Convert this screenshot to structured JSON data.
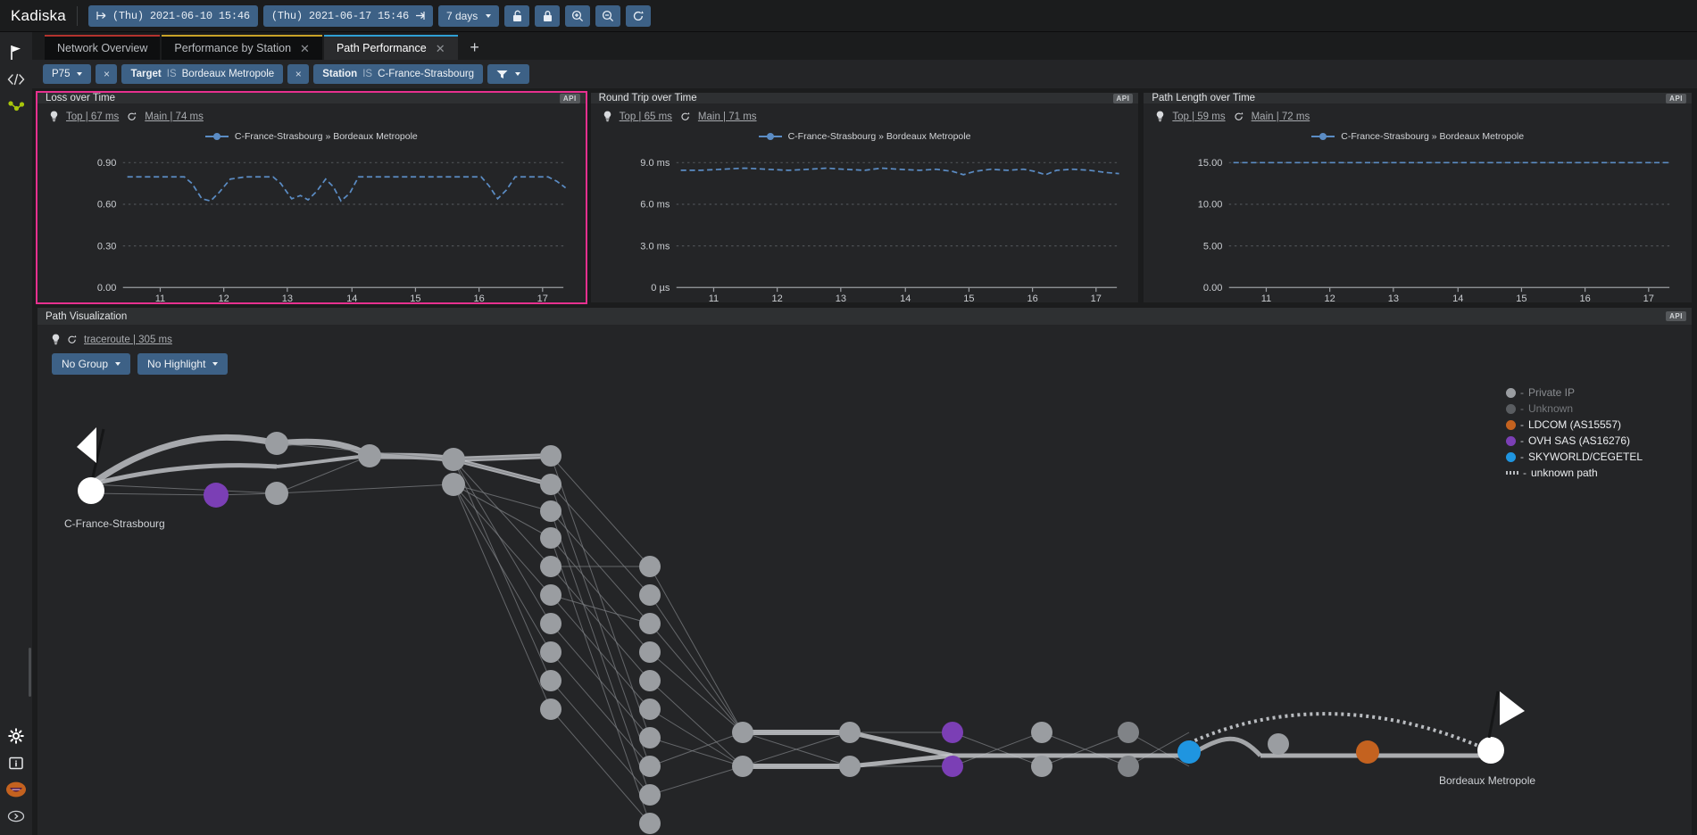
{
  "topbar": {
    "brand": "Kadiska",
    "start_date": "(Thu) 2021-06-10 15:46",
    "end_date": "(Thu) 2021-06-17 15:46",
    "range_label": "7 days",
    "icons": [
      "lock-open-icon",
      "lock-closed-icon",
      "zoom-in-icon",
      "zoom-out-icon",
      "refresh-icon"
    ]
  },
  "rail": {
    "items": [
      {
        "name": "flag-icon",
        "label": "flag"
      },
      {
        "name": "code-icon",
        "label": "</>"
      },
      {
        "name": "path-graph-icon",
        "label": "path"
      }
    ],
    "bottom": [
      {
        "name": "gear-icon",
        "label": "settings"
      },
      {
        "name": "info-box-icon",
        "label": "info"
      },
      {
        "name": "avatar-icon",
        "label": "user"
      },
      {
        "name": "collapse-icon",
        "label": "expand"
      }
    ]
  },
  "tabs": [
    {
      "label": "Network Overview",
      "accent": "#b4332e",
      "closable": false,
      "active": false
    },
    {
      "label": "Performance by Station",
      "accent": "#c9a227",
      "closable": true,
      "active": false
    },
    {
      "label": "Path Performance",
      "accent": "#2f9fd4",
      "closable": true,
      "active": true
    }
  ],
  "tab_add_label": "+",
  "filters": {
    "percentile": "P75",
    "chips": [
      {
        "remove": "×",
        "key": "Target",
        "op": "IS",
        "value": "Bordeaux Metropole"
      },
      {
        "remove": "×",
        "key": "Station",
        "op": "IS",
        "value": "C-France-Strasbourg"
      }
    ],
    "funnel_label": "filter-icon"
  },
  "panels": [
    {
      "title": "Loss over Time",
      "badge": "API",
      "selected": true,
      "links": [
        {
          "text": "Top | 67 ms"
        },
        {
          "text": "Main | 74 ms"
        }
      ],
      "legend": "C-France-Strasbourg » Bordeaux Metropole"
    },
    {
      "title": "Round Trip over Time",
      "badge": "API",
      "selected": false,
      "links": [
        {
          "text": "Top | 65 ms"
        },
        {
          "text": "Main | 71 ms"
        }
      ],
      "legend": "C-France-Strasbourg » Bordeaux Metropole"
    },
    {
      "title": "Path Length over Time",
      "badge": "API",
      "selected": false,
      "links": [
        {
          "text": "Top | 59 ms"
        },
        {
          "text": "Main | 72 ms"
        }
      ],
      "legend": "C-France-Strasbourg » Bordeaux Metropole"
    }
  ],
  "path_panel": {
    "title": "Path Visualization",
    "badge": "API",
    "link": "traceroute | 305 ms",
    "group_button": "No Group",
    "highlight_button": "No Highlight",
    "source_label": "C-France-Strasbourg",
    "target_label": "Bordeaux Metropole",
    "legend": [
      {
        "label": "Private IP",
        "color": "#9a9da1",
        "type": "dot",
        "dim": true
      },
      {
        "label": "Unknown",
        "color": "#5a5d61",
        "type": "dot",
        "dim": true
      },
      {
        "label": "LDCOM (AS15557)",
        "color": "#c4621f",
        "type": "dot",
        "dim": false
      },
      {
        "label": "OVH SAS (AS16276)",
        "color": "#7b3fb5",
        "type": "dot",
        "dim": false
      },
      {
        "label": "SKYWORLD/CEGETEL",
        "color": "#1f95e0",
        "type": "dot",
        "dim": false
      },
      {
        "label": "unknown path",
        "color": "#b9bcc0",
        "type": "dash",
        "dim": false
      }
    ]
  },
  "chart_data": [
    {
      "type": "line",
      "title": "Loss over Time",
      "xlabel": "",
      "ylabel": "",
      "series": [
        {
          "name": "C-France-Strasbourg » Bordeaux Metropole",
          "color": "#5b8cc4",
          "values": [
            0.8,
            0.8,
            0.8,
            0.8,
            0.8,
            0.8,
            0.8,
            0.8,
            0.7,
            0.67,
            0.68,
            0.72,
            0.8,
            0.8,
            0.8,
            0.8,
            0.8,
            0.8,
            0.8,
            0.7,
            0.68,
            0.72,
            0.7,
            0.68,
            0.72,
            0.8,
            0.8,
            0.72,
            0.68,
            0.8,
            0.8,
            0.8,
            0.8,
            0.8,
            0.8,
            0.8,
            0.8,
            0.8,
            0.8,
            0.8,
            0.8,
            0.8,
            0.8,
            0.8,
            0.8,
            0.8,
            0.8,
            0.8,
            0.72,
            0.68,
            0.76,
            0.8,
            0.8,
            0.8,
            0.8,
            0.8,
            0.8,
            0.8,
            0.78,
            0.75
          ]
        }
      ],
      "x": [
        11,
        12,
        13,
        14,
        15,
        16,
        17
      ],
      "xticklabels": [
        "11",
        "12",
        "13",
        "14",
        "15",
        "16",
        "17"
      ],
      "yticklabels": [
        "0.90",
        "0.60",
        "0.30",
        "0.00"
      ],
      "yticks": [
        0.9,
        0.6,
        0.3,
        0.0
      ],
      "ylim": [
        0,
        1.05
      ],
      "grid": true,
      "legend_position": "top"
    },
    {
      "type": "line",
      "title": "Round Trip over Time",
      "xlabel": "",
      "ylabel": "ms",
      "series": [
        {
          "name": "C-France-Strasbourg » Bordeaux Metropole",
          "color": "#5b8cc4",
          "values": [
            8.5,
            8.5,
            8.6,
            8.6,
            8.7,
            8.7,
            8.7,
            8.6,
            8.6,
            8.6,
            8.6,
            8.6,
            8.6,
            8.7,
            8.7,
            8.6,
            8.6,
            8.6,
            8.5,
            8.5,
            8.6,
            8.6,
            8.6,
            8.6,
            8.7,
            8.7,
            8.6,
            8.6,
            8.6,
            8.6,
            8.7,
            8.7,
            8.6,
            8.5,
            8.6,
            8.6,
            8.6,
            8.5,
            8.4,
            8.3,
            8.5,
            8.6,
            8.6,
            8.6,
            8.5,
            8.5,
            8.6,
            8.6,
            8.5,
            8.3,
            8.2,
            8.4,
            8.6,
            8.6,
            8.6,
            8.6,
            8.5,
            8.4,
            8.3,
            8.2
          ]
        }
      ],
      "x": [
        11,
        12,
        13,
        14,
        15,
        16,
        17
      ],
      "xticklabels": [
        "11",
        "12",
        "13",
        "14",
        "15",
        "16",
        "17"
      ],
      "yticklabels": [
        "9.0 ms",
        "6.0 ms",
        "3.0 ms",
        "0 µs"
      ],
      "yticks": [
        9.0,
        6.0,
        3.0,
        0.0
      ],
      "ylim": [
        0,
        10.5
      ],
      "grid": true,
      "legend_position": "top"
    },
    {
      "type": "line",
      "title": "Path Length over Time",
      "xlabel": "",
      "ylabel": "",
      "series": [
        {
          "name": "C-France-Strasbourg » Bordeaux Metropole",
          "color": "#5b8cc4",
          "values": [
            15,
            15,
            15,
            15,
            15,
            15,
            15,
            15,
            15,
            15,
            15,
            15,
            15,
            15,
            15,
            15,
            15,
            15,
            15,
            15,
            15,
            15,
            15,
            15,
            15,
            15,
            15,
            15,
            15,
            15,
            15,
            15,
            15,
            15,
            15,
            15,
            15,
            15,
            15,
            15,
            15,
            15,
            15,
            15,
            15,
            15,
            15,
            15,
            15,
            15,
            15,
            15,
            15,
            15,
            15,
            15,
            15,
            15,
            15,
            15
          ]
        }
      ],
      "x": [
        11,
        12,
        13,
        14,
        15,
        16,
        17
      ],
      "xticklabels": [
        "11",
        "12",
        "13",
        "14",
        "15",
        "16",
        "17"
      ],
      "yticklabels": [
        "15.00",
        "10.00",
        "5.00",
        "0.00"
      ],
      "yticks": [
        15,
        10,
        5,
        0
      ],
      "ylim": [
        0,
        17.5
      ],
      "grid": true,
      "legend_position": "top"
    }
  ]
}
